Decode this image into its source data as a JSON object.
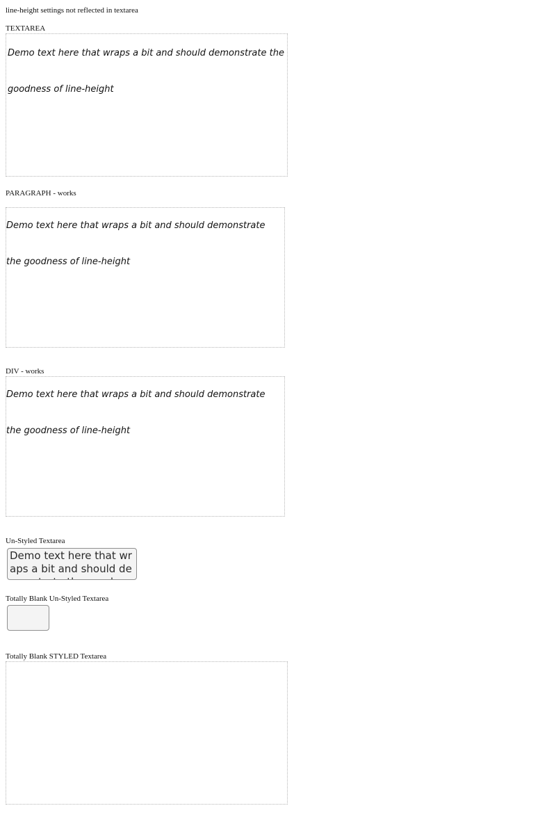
{
  "page_title": "line-height settings not reflected in textarea",
  "sections": {
    "textarea": {
      "label": "TEXTAREA",
      "value": "Demo text here that wraps a bit and should demonstrate the goodness of line-height"
    },
    "paragraph": {
      "label": "PARAGRAPH - works",
      "line1": "Demo text here that wraps a bit and should demonstrate",
      "line2": "the goodness of line-height"
    },
    "div": {
      "label": "DIV - works",
      "line1": "Demo text here that wraps a bit and should demonstrate",
      "line2": "the goodness of line-height"
    },
    "unstyled_textarea": {
      "label": "Un-Styled Textarea",
      "value": "Demo text here that wraps a bit and should demonstrate the goodness of line-height"
    },
    "blank_unstyled_textarea": {
      "label": "Totally Blank Un-Styled Textarea",
      "value": ""
    },
    "blank_styled_textarea": {
      "label": "Totally Blank STYLED Textarea",
      "value": ""
    }
  }
}
